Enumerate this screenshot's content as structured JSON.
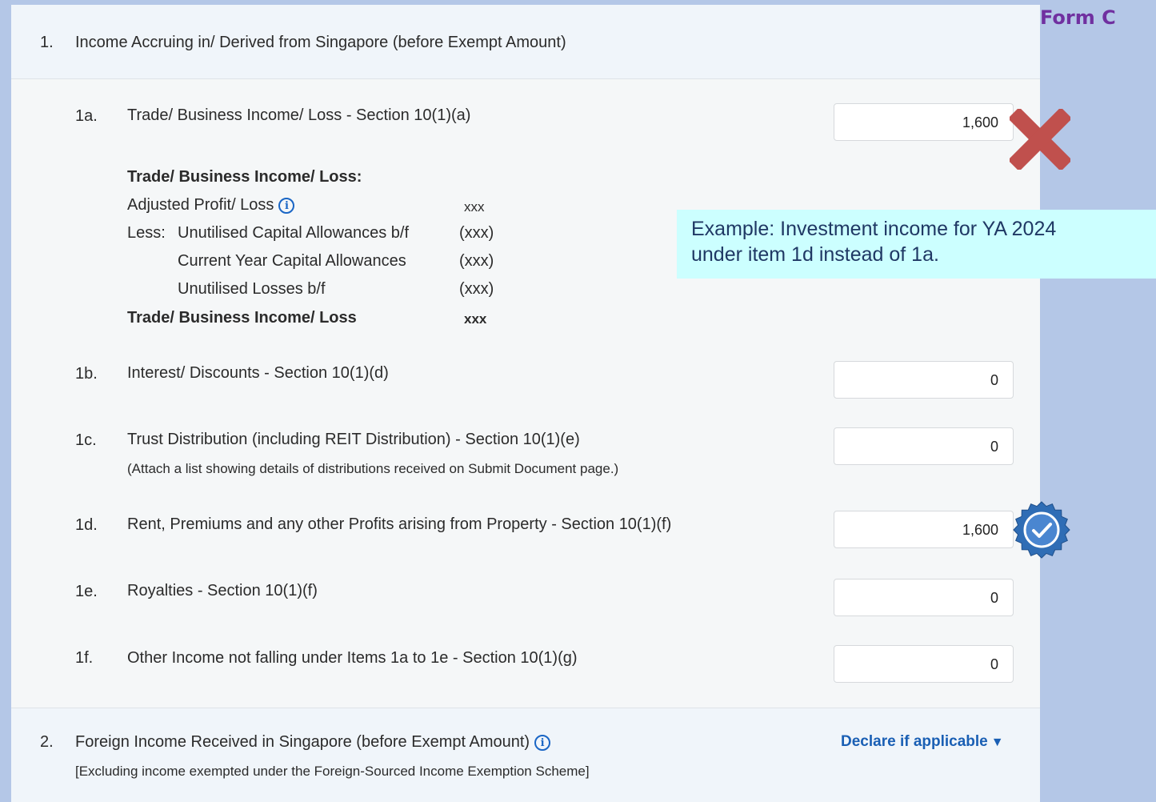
{
  "form_label": "Form C",
  "section1": {
    "number": "1.",
    "title": "Income Accruing in/ Derived from Singapore (before Exempt Amount)"
  },
  "items": {
    "1a": {
      "code": "1a.",
      "label": "Trade/ Business Income/ Loss - Section 10(1)(a)",
      "value": "1,600"
    },
    "1b": {
      "code": "1b.",
      "label": "Interest/ Discounts - Section 10(1)(d)",
      "value": "0"
    },
    "1c": {
      "code": "1c.",
      "label": "Trust Distribution (including REIT Distribution) - Section 10(1)(e)",
      "note": "(Attach a list showing details of distributions received on Submit Document page.)",
      "value": "0"
    },
    "1d": {
      "code": "1d.",
      "label": "Rent, Premiums and any other Profits arising from Property - Section 10(1)(f)",
      "value": "1,600"
    },
    "1e": {
      "code": "1e.",
      "label": "Royalties - Section 10(1)(f)",
      "value": "0"
    },
    "1f": {
      "code": "1f.",
      "label": "Other Income not falling under Items 1a to 1e - Section 10(1)(g)",
      "value": "0"
    }
  },
  "breakdown": {
    "heading": "Trade/ Business Income/ Loss:",
    "adjusted_label": "Adjusted Profit/ Loss",
    "adjusted_value": "xxx",
    "less_label": "Less:",
    "unutilised_ca_label": "Unutilised Capital Allowances b/f",
    "unutilised_ca_value": "(xxx)",
    "current_ca_label": "Current Year Capital Allowances",
    "current_ca_value": "(xxx)",
    "unutilised_losses_label": "Unutilised Losses b/f",
    "unutilised_losses_value": "(xxx)",
    "total_label": "Trade/ Business Income/ Loss",
    "total_value": "xxx"
  },
  "section2": {
    "number": "2.",
    "title": "Foreign Income Received in Singapore (before Exempt Amount)",
    "note": "[Excluding income exempted under the Foreign-Sourced Income Exemption Scheme]",
    "declare_label": "Declare if applicable"
  },
  "callout": {
    "line1": "Example: Investment income for YA 2024",
    "line2": "under item 1d instead of 1a."
  },
  "colors": {
    "background": "#b4c7e7",
    "accent_blue": "#1a5fb4",
    "form_label": "#7030a0",
    "wrong_mark": "#c0504d",
    "correct_badge": "#2f6db5",
    "callout_bg": "#ccffff"
  },
  "icons": [
    "info-icon",
    "cross-icon",
    "verified-badge-icon",
    "triangle-down-icon"
  ]
}
